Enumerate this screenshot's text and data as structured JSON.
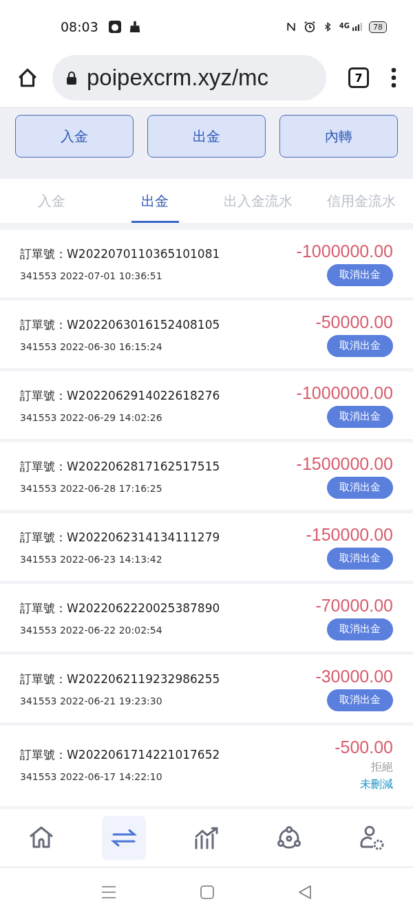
{
  "status_bar": {
    "time": "08:03",
    "network": "4G",
    "battery": "78"
  },
  "browser": {
    "url": "poipexcrm.xyz/mc",
    "tab_count": "7"
  },
  "actions": [
    "入金",
    "出金",
    "內轉"
  ],
  "tabs": [
    {
      "label": "入金",
      "selected": false
    },
    {
      "label": "出金",
      "selected": true
    },
    {
      "label": "出入金流水",
      "selected": false
    },
    {
      "label": "信用金流水",
      "selected": false
    }
  ],
  "orders": [
    {
      "order": "訂單號：W2022070110365101081",
      "meta": "341553 2022-07-01 10:36:51",
      "amount": "-1000000.00",
      "kind": "cancel",
      "action": "取消出金"
    },
    {
      "order": "訂單號：W2022063016152408105",
      "meta": "341553 2022-06-30 16:15:24",
      "amount": "-50000.00",
      "kind": "cancel",
      "action": "取消出金"
    },
    {
      "order": "訂單號：W2022062914022618276",
      "meta": "341553 2022-06-29 14:02:26",
      "amount": "-1000000.00",
      "kind": "cancel",
      "action": "取消出金"
    },
    {
      "order": "訂單號：W2022062817162517515",
      "meta": "341553 2022-06-28 17:16:25",
      "amount": "-1500000.00",
      "kind": "cancel",
      "action": "取消出金"
    },
    {
      "order": "訂單號：W2022062314134111279",
      "meta": "341553 2022-06-23 14:13:42",
      "amount": "-150000.00",
      "kind": "cancel",
      "action": "取消出金"
    },
    {
      "order": "訂單號：W2022062220025387890",
      "meta": "341553 2022-06-22 20:02:54",
      "amount": "-70000.00",
      "kind": "cancel",
      "action": "取消出金"
    },
    {
      "order": "訂單號：W2022062119232986255",
      "meta": "341553 2022-06-21 19:23:30",
      "amount": "-30000.00",
      "kind": "cancel",
      "action": "取消出金"
    },
    {
      "order": "訂單號：W2022061714221017652",
      "meta": "341553 2022-06-17 14:22:10",
      "amount": "-500.00",
      "kind": "status",
      "status": "拒絕",
      "note": "未刪減"
    }
  ],
  "nav": [
    {
      "kind": "home",
      "selected": false
    },
    {
      "kind": "transfer",
      "selected": true
    },
    {
      "kind": "chart",
      "selected": false
    },
    {
      "kind": "network",
      "selected": false
    },
    {
      "kind": "user-settings",
      "selected": false
    }
  ]
}
